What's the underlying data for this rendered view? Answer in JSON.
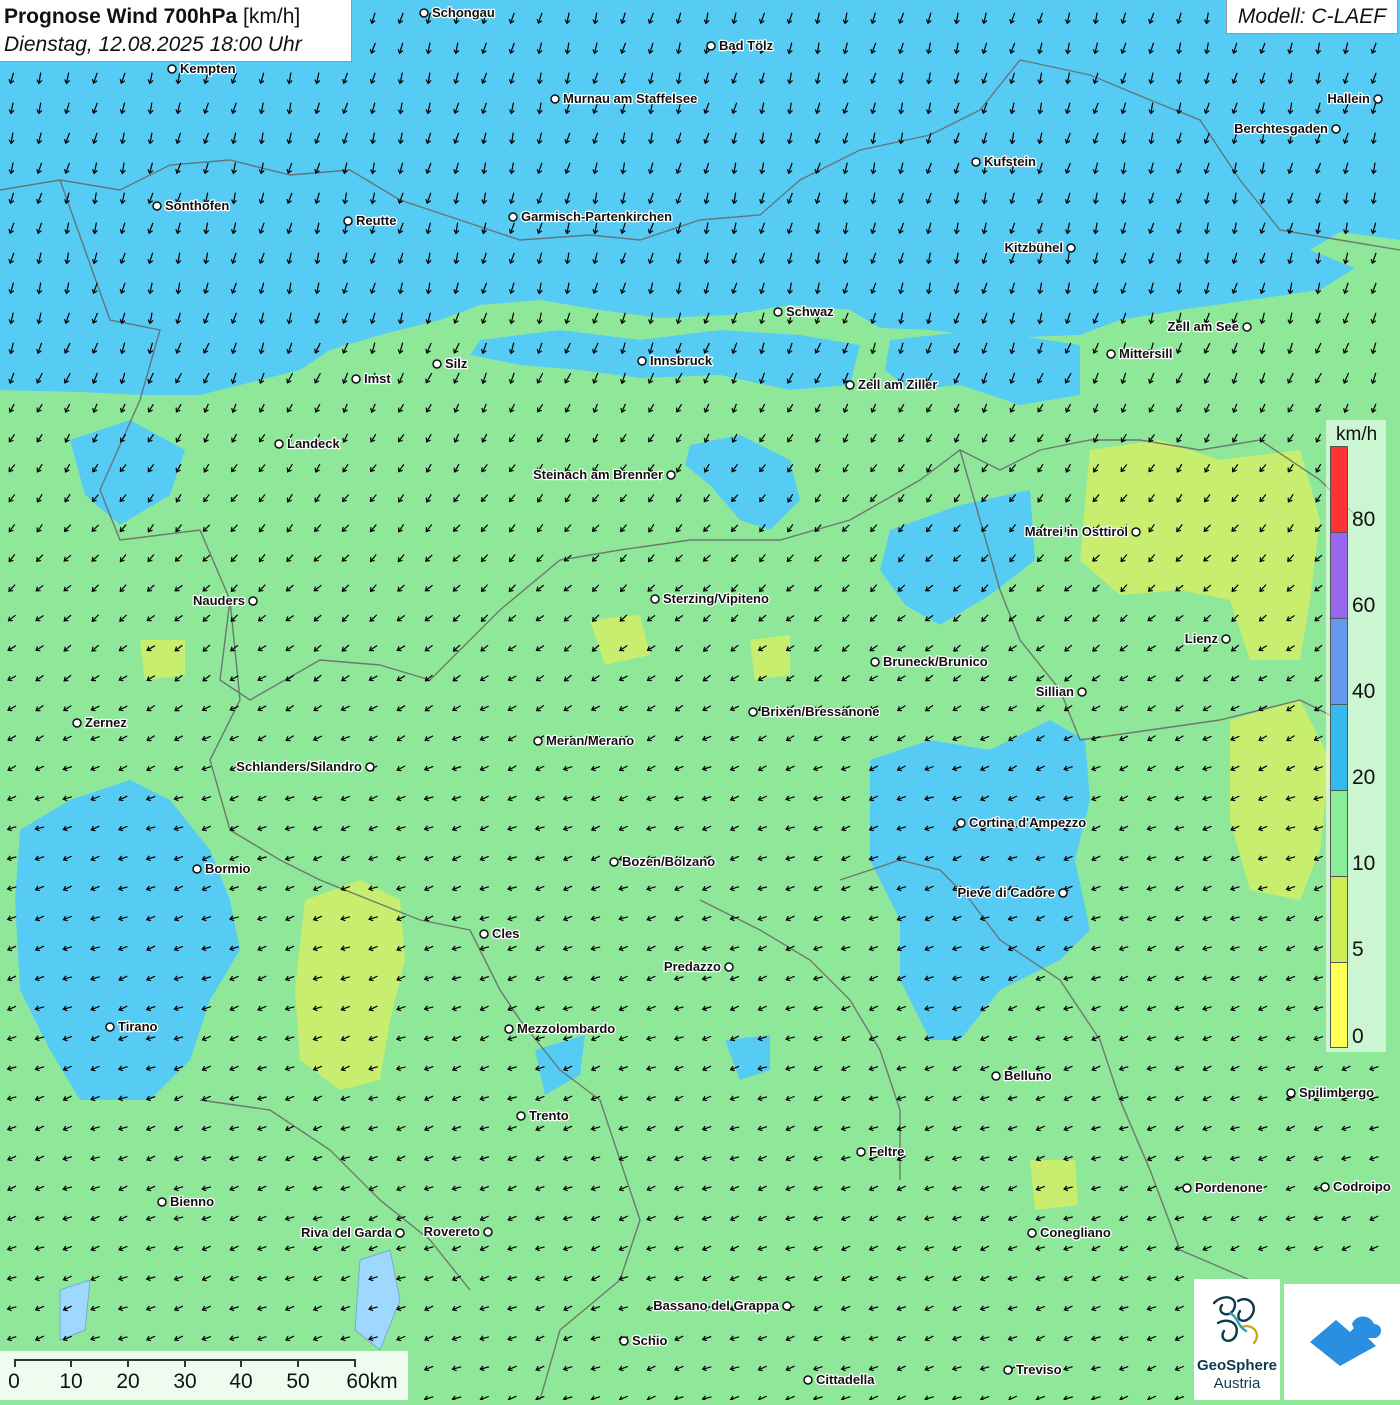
{
  "title": {
    "main_bold": "Prognose Wind 700hPa",
    "main_unit": "[km/h]",
    "datetime": "Dienstag, 12.08.2025 18:00 Uhr"
  },
  "model": "Modell: C-LAEF",
  "legend": {
    "unit": "km/h",
    "labels": [
      "80",
      "60",
      "40",
      "20",
      "10",
      "5",
      "0"
    ],
    "colors": [
      "#ff3333",
      "#9966ee",
      "#6699ee",
      "#33bbee",
      "#88ee99",
      "#ccee55",
      "#ffff55"
    ]
  },
  "scale_bar": {
    "labels": [
      "0",
      "10",
      "20",
      "30",
      "40",
      "50",
      "60km"
    ]
  },
  "wind": {
    "north_direction_deg": 105,
    "south_direction_deg": 160,
    "arrow_color": "#000000"
  },
  "colors": {
    "strong_wind": "#55ccf5",
    "medium_wind": "#33bbee",
    "light_wind": "#88ee99",
    "calm": "#ccee66",
    "border": "#666666"
  },
  "cities": [
    {
      "name": "Schongau"
    },
    {
      "name": "Bad Tölz"
    },
    {
      "name": "Kempten"
    },
    {
      "name": "Murnau am Staffelsee"
    },
    {
      "name": "Hallein"
    },
    {
      "name": "Berchtesgaden"
    },
    {
      "name": "Kufstein"
    },
    {
      "name": "Sonthofen"
    },
    {
      "name": "Reutte"
    },
    {
      "name": "Garmisch-Partenkirchen"
    },
    {
      "name": "Kitzbühel"
    },
    {
      "name": "Schwaz"
    },
    {
      "name": "Zell am See"
    },
    {
      "name": "Mittersill"
    },
    {
      "name": "Innsbruck"
    },
    {
      "name": "Silz"
    },
    {
      "name": "Imst"
    },
    {
      "name": "Zell am Ziller"
    },
    {
      "name": "Landeck"
    },
    {
      "name": "Steinach am Brenner"
    },
    {
      "name": "Matrei in Osttirol"
    },
    {
      "name": "Nauders"
    },
    {
      "name": "Sterzing/Vipiteno"
    },
    {
      "name": "Lienz"
    },
    {
      "name": "Bruneck/Brunico"
    },
    {
      "name": "Sillian"
    },
    {
      "name": "Brixen/Bressanone"
    },
    {
      "name": "Zernez"
    },
    {
      "name": "Meran/Merano"
    },
    {
      "name": "Schlanders/Silandro"
    },
    {
      "name": "Cortina d'Ampezzo"
    },
    {
      "name": "Bozen/Bolzano"
    },
    {
      "name": "Bormio"
    },
    {
      "name": "Pieve di Cadore"
    },
    {
      "name": "Cles"
    },
    {
      "name": "Predazzo"
    },
    {
      "name": "Tirano"
    },
    {
      "name": "Mezzolombardo"
    },
    {
      "name": "Belluno"
    },
    {
      "name": "Spilimbergo"
    },
    {
      "name": "Trento"
    },
    {
      "name": "Feltre"
    },
    {
      "name": "Bienno"
    },
    {
      "name": "Pordenone"
    },
    {
      "name": "Codroipo"
    },
    {
      "name": "Riva del Garda"
    },
    {
      "name": "Rovereto"
    },
    {
      "name": "Conegliano"
    },
    {
      "name": "Bassano del Grappa"
    },
    {
      "name": "Schio"
    },
    {
      "name": "Treviso"
    },
    {
      "name": "Cittadella"
    }
  ],
  "logos": {
    "geosphere_line1": "GeoSphere",
    "geosphere_line2": "Austria"
  }
}
